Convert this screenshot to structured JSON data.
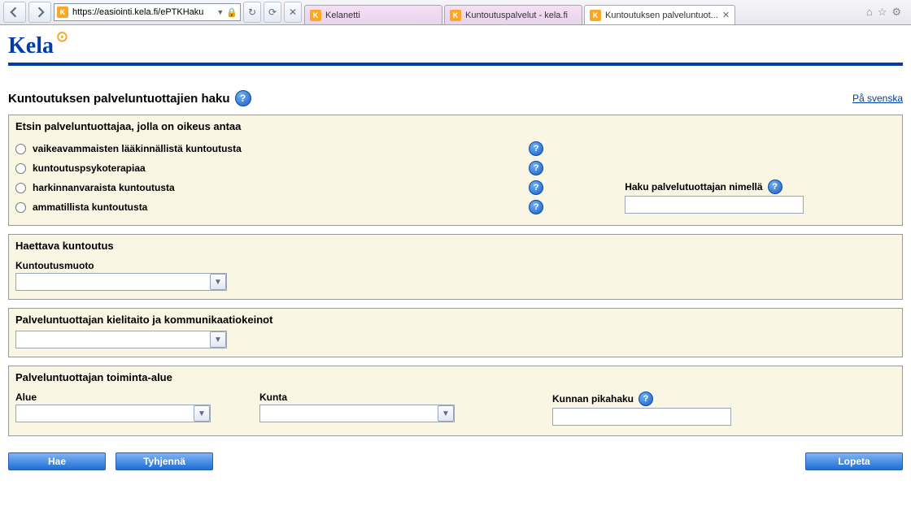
{
  "browser": {
    "url": "https://easiointi.kela.fi/ePTKHaku",
    "tabs": [
      {
        "label": "Kelanetti",
        "active": false
      },
      {
        "label": "Kuntoutuspalvelut - kela.fi",
        "active": false
      },
      {
        "label": "Kuntoutuksen palveluntuot...",
        "active": true
      }
    ]
  },
  "logo": "Kela",
  "title": "Kuntoutuksen palveluntuottajien haku",
  "svenska": "På svenska",
  "section1": {
    "heading": "Etsin palveluntuottajaa, jolla on oikeus antaa",
    "options": [
      "vaikeavammaisten lääkinnällistä kuntoutusta",
      "kuntoutuspsykoterapiaa",
      "harkinnanvaraista kuntoutusta",
      "ammatillista kuntoutusta"
    ],
    "nameSearchLabel": "Haku palvelutuottajan nimellä"
  },
  "section2": {
    "heading": "Haettava kuntoutus",
    "formLabel": "Kuntoutusmuoto"
  },
  "section3": {
    "heading": "Palveluntuottajan kielitaito ja kommunikaatiokeinot"
  },
  "section4": {
    "heading": "Palveluntuottajan toiminta-alue",
    "alueLabel": "Alue",
    "kuntaLabel": "Kunta",
    "pikahakuLabel": "Kunnan pikahaku"
  },
  "buttons": {
    "search": "Hae",
    "clear": "Tyhjennä",
    "exit": "Lopeta"
  }
}
